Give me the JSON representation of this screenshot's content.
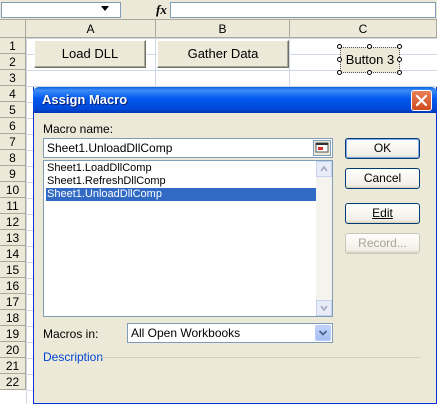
{
  "spreadsheet": {
    "formula_bar": {
      "fx_label": "fx"
    },
    "columns": [
      "A",
      "B",
      "C"
    ],
    "rows": [
      "1",
      "2",
      "3",
      "4",
      "5",
      "6",
      "7",
      "8",
      "9",
      "10",
      "11",
      "12",
      "13",
      "14",
      "15",
      "16",
      "17",
      "18",
      "19",
      "20",
      "21",
      "22"
    ],
    "buttons": {
      "load_dll": "Load DLL",
      "gather_data": "Gather Data",
      "button3": "Button 3"
    }
  },
  "dialog": {
    "title": "Assign Macro",
    "macro_name_label": "Macro name:",
    "macro_name_value": "Sheet1.UnloadDllComp",
    "macros": [
      "Sheet1.LoadDllComp",
      "Sheet1.RefreshDllComp",
      "Sheet1.UnloadDllComp"
    ],
    "selected_macro": "Sheet1.UnloadDllComp",
    "buttons": {
      "ok": "OK",
      "cancel": "Cancel",
      "edit": "Edit",
      "record": "Record..."
    },
    "macros_in_label": "Macros in:",
    "macros_in_value": "All Open Workbooks",
    "description_label": "Description"
  },
  "colors": {
    "title_bar": "#0058ee",
    "selection": "#316ac5",
    "dialog_bg": "#ece9d8",
    "close_button": "#d04a1e",
    "description_label": "#0046d5"
  },
  "icons": [
    "dropdown-arrow-icon",
    "fx-icon",
    "close-icon",
    "collapse-dialog-icon",
    "scroll-up-icon",
    "scroll-down-icon",
    "chevron-down-icon"
  ]
}
